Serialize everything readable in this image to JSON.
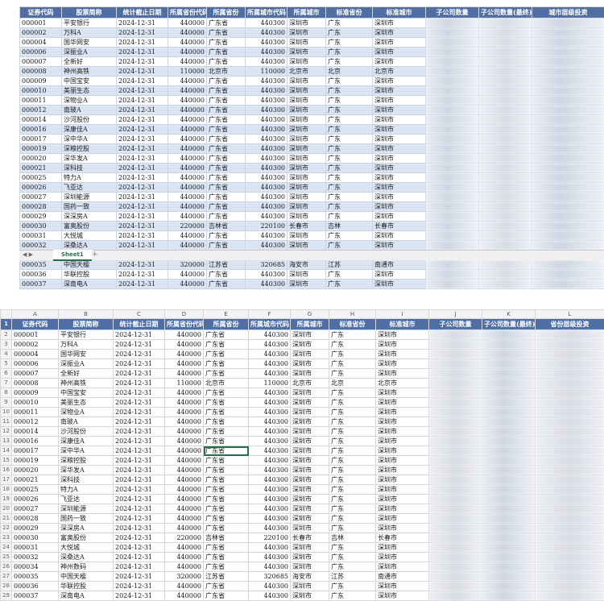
{
  "headers": [
    "证券代码",
    "股票简称",
    "统计截止日期",
    "所属省份代码",
    "所属省份",
    "所属城市代码",
    "所属城市",
    "标准省份",
    "标准城市",
    "子公司数量",
    "子公司数量(最终)",
    "城市层级投资"
  ],
  "bottom_headers": [
    "证券代码",
    "股票简称",
    "统计截止日期",
    "所属省份代码",
    "所属省份",
    "所属城市代码",
    "所属城市",
    "标准省份",
    "标准城市",
    "子公司数量",
    "子公司数量(最终)",
    "省份层级投资"
  ],
  "column_letters": [
    "A",
    "B",
    "C",
    "D",
    "E",
    "F",
    "G",
    "H",
    "I",
    "J",
    "K",
    "L"
  ],
  "sheet_tab": "Sheet1",
  "tab_nav": "◀ ▶",
  "add_sheet": "+",
  "top_last_col": [
    "",
    "",
    "",
    "",
    "",
    "",
    "",
    "",
    "",
    "",
    "",
    "",
    "",
    "",
    "",
    "",
    "",
    "",
    "",
    "",
    "",
    "",
    "",
    "",
    "",
    "",
    "",
    ""
  ],
  "bottom_last_col": [
    "",
    "",
    "",
    "",
    "",
    "",
    "",
    "",
    "",
    "",
    "",
    "",
    "",
    "",
    "",
    "",
    "",
    "",
    "",
    "",
    "",
    "",
    "",
    "",
    "",
    "",
    "",
    "",
    ""
  ],
  "top_rows": [
    [
      "000001",
      "平安银行",
      "2024-12-31",
      "440000",
      "广东省",
      "440300",
      "深圳市",
      "广东",
      "深圳市"
    ],
    [
      "000002",
      "万科A",
      "2024-12-31",
      "440000",
      "广东省",
      "440300",
      "深圳市",
      "广东",
      "深圳市"
    ],
    [
      "000004",
      "国华网安",
      "2024-12-31",
      "440000",
      "广东省",
      "440300",
      "深圳市",
      "广东",
      "深圳市"
    ],
    [
      "000006",
      "深振业A",
      "2024-12-31",
      "440000",
      "广东省",
      "440300",
      "深圳市",
      "广东",
      "深圳市"
    ],
    [
      "000007",
      "全新好",
      "2024-12-31",
      "440000",
      "广东省",
      "440300",
      "深圳市",
      "广东",
      "深圳市"
    ],
    [
      "000008",
      "神州高铁",
      "2024-12-31",
      "110000",
      "北京市",
      "110000",
      "北京市",
      "北京",
      "北京市"
    ],
    [
      "000009",
      "中国宝安",
      "2024-12-31",
      "440000",
      "广东省",
      "440300",
      "深圳市",
      "广东",
      "深圳市"
    ],
    [
      "000010",
      "美丽生态",
      "2024-12-31",
      "440000",
      "广东省",
      "440300",
      "深圳市",
      "广东",
      "深圳市"
    ],
    [
      "000011",
      "深物业A",
      "2024-12-31",
      "440000",
      "广东省",
      "440300",
      "深圳市",
      "广东",
      "深圳市"
    ],
    [
      "000012",
      "南玻A",
      "2024-12-31",
      "440000",
      "广东省",
      "440300",
      "深圳市",
      "广东",
      "深圳市"
    ],
    [
      "000014",
      "沙河股份",
      "2024-12-31",
      "440000",
      "广东省",
      "440300",
      "深圳市",
      "广东",
      "深圳市"
    ],
    [
      "000016",
      "深康佳A",
      "2024-12-31",
      "440000",
      "广东省",
      "440300",
      "深圳市",
      "广东",
      "深圳市"
    ],
    [
      "000017",
      "深中华A",
      "2024-12-31",
      "440000",
      "广东省",
      "440300",
      "深圳市",
      "广东",
      "深圳市"
    ],
    [
      "000019",
      "深粮控股",
      "2024-12-31",
      "440000",
      "广东省",
      "440300",
      "深圳市",
      "广东",
      "深圳市"
    ],
    [
      "000020",
      "深华发A",
      "2024-12-31",
      "440000",
      "广东省",
      "440300",
      "深圳市",
      "广东",
      "深圳市"
    ],
    [
      "000021",
      "深科技",
      "2024-12-31",
      "440000",
      "广东省",
      "440300",
      "深圳市",
      "广东",
      "深圳市"
    ],
    [
      "000025",
      "特力A",
      "2024-12-31",
      "440000",
      "广东省",
      "440300",
      "深圳市",
      "广东",
      "深圳市"
    ],
    [
      "000026",
      "飞亚达",
      "2024-12-31",
      "440000",
      "广东省",
      "440300",
      "深圳市",
      "广东",
      "深圳市"
    ],
    [
      "000027",
      "深圳能源",
      "2024-12-31",
      "440000",
      "广东省",
      "440300",
      "深圳市",
      "广东",
      "深圳市"
    ],
    [
      "000028",
      "国药一致",
      "2024-12-31",
      "440000",
      "广东省",
      "440300",
      "深圳市",
      "广东",
      "深圳市"
    ],
    [
      "000029",
      "深深房A",
      "2024-12-31",
      "440000",
      "广东省",
      "440300",
      "深圳市",
      "广东",
      "深圳市"
    ],
    [
      "000030",
      "富奥股份",
      "2024-12-31",
      "220000",
      "吉林省",
      "220100",
      "长春市",
      "吉林",
      "长春市"
    ],
    [
      "000031",
      "大悦城",
      "2024-12-31",
      "440000",
      "广东省",
      "440300",
      "深圳市",
      "广东",
      "深圳市"
    ],
    [
      "000032",
      "深桑达A",
      "2024-12-31",
      "440000",
      "广东省",
      "440300",
      "深圳市",
      "广东",
      "深圳市"
    ],
    [
      "000034",
      "神州数码",
      "2024-12-31",
      "440000",
      "广东省",
      "440300",
      "深圳市",
      "广东",
      "深圳市"
    ],
    [
      "000035",
      "中国天楹",
      "2024-12-31",
      "320000",
      "江苏省",
      "320685",
      "海安市",
      "江苏",
      "南通市"
    ],
    [
      "000036",
      "华联控股",
      "2024-12-31",
      "440000",
      "广东省",
      "440300",
      "深圳市",
      "广东",
      "深圳市"
    ],
    [
      "000037",
      "深南电A",
      "2024-12-31",
      "440000",
      "广东省",
      "440300",
      "深圳市",
      "广东",
      "深圳市"
    ]
  ],
  "bottom_rows": [
    [
      "000001",
      "平安银行",
      "2024-12-31",
      "440000",
      "广东省",
      "440300",
      "深圳市",
      "广东",
      "深圳市"
    ],
    [
      "000002",
      "万科A",
      "2024-12-31",
      "440000",
      "广东省",
      "440300",
      "深圳市",
      "广东",
      "深圳市"
    ],
    [
      "000004",
      "国华网安",
      "2024-12-31",
      "440000",
      "广东省",
      "440300",
      "深圳市",
      "广东",
      "深圳市"
    ],
    [
      "000006",
      "深振业A",
      "2024-12-31",
      "440000",
      "广东省",
      "440300",
      "深圳市",
      "广东",
      "深圳市"
    ],
    [
      "000007",
      "全新好",
      "2024-12-31",
      "440000",
      "广东省",
      "440300",
      "深圳市",
      "广东",
      "深圳市"
    ],
    [
      "000008",
      "神州高铁",
      "2024-12-31",
      "110000",
      "北京市",
      "110000",
      "北京市",
      "北京",
      "北京市"
    ],
    [
      "000009",
      "中国宝安",
      "2024-12-31",
      "440000",
      "广东省",
      "440300",
      "深圳市",
      "广东",
      "深圳市"
    ],
    [
      "000010",
      "美丽生态",
      "2024-12-31",
      "440000",
      "广东省",
      "440300",
      "深圳市",
      "广东",
      "深圳市"
    ],
    [
      "000011",
      "深物业A",
      "2024-12-31",
      "440000",
      "广东省",
      "440300",
      "深圳市",
      "广东",
      "深圳市"
    ],
    [
      "000012",
      "南玻A",
      "2024-12-31",
      "440000",
      "广东省",
      "440300",
      "深圳市",
      "广东",
      "深圳市"
    ],
    [
      "000014",
      "沙河股份",
      "2024-12-31",
      "440000",
      "广东省",
      "440300",
      "深圳市",
      "广东",
      "深圳市"
    ],
    [
      "000016",
      "深康佳A",
      "2024-12-31",
      "440000",
      "广东省",
      "440300",
      "深圳市",
      "广东",
      "深圳市"
    ],
    [
      "000017",
      "深中华A",
      "2024-12-31",
      "440000",
      "广东省",
      "440300",
      "深圳市",
      "广东",
      "深圳市"
    ],
    [
      "000019",
      "深粮控股",
      "2024-12-31",
      "440000",
      "广东省",
      "440300",
      "深圳市",
      "广东",
      "深圳市"
    ],
    [
      "000020",
      "深华发A",
      "2024-12-31",
      "440000",
      "广东省",
      "440300",
      "深圳市",
      "广东",
      "深圳市"
    ],
    [
      "000021",
      "深科技",
      "2024-12-31",
      "440000",
      "广东省",
      "440300",
      "深圳市",
      "广东",
      "深圳市"
    ],
    [
      "000025",
      "特力A",
      "2024-12-31",
      "440000",
      "广东省",
      "440300",
      "深圳市",
      "广东",
      "深圳市"
    ],
    [
      "000026",
      "飞亚达",
      "2024-12-31",
      "440000",
      "广东省",
      "440300",
      "深圳市",
      "广东",
      "深圳市"
    ],
    [
      "000027",
      "深圳能源",
      "2024-12-31",
      "440000",
      "广东省",
      "440300",
      "深圳市",
      "广东",
      "深圳市"
    ],
    [
      "000028",
      "国药一致",
      "2024-12-31",
      "440000",
      "广东省",
      "440300",
      "深圳市",
      "广东",
      "深圳市"
    ],
    [
      "000029",
      "深深房A",
      "2024-12-31",
      "440000",
      "广东省",
      "440300",
      "深圳市",
      "广东",
      "深圳市"
    ],
    [
      "000030",
      "富奥股份",
      "2024-12-31",
      "220000",
      "吉林省",
      "220100",
      "长春市",
      "吉林",
      "长春市"
    ],
    [
      "000031",
      "大悦城",
      "2024-12-31",
      "440000",
      "广东省",
      "440300",
      "深圳市",
      "广东",
      "深圳市"
    ],
    [
      "000032",
      "深桑达A",
      "2024-12-31",
      "440000",
      "广东省",
      "440300",
      "深圳市",
      "广东",
      "深圳市"
    ],
    [
      "000034",
      "神州数码",
      "2024-12-31",
      "440000",
      "广东省",
      "440300",
      "深圳市",
      "广东",
      "深圳市"
    ],
    [
      "000035",
      "中国天楹",
      "2024-12-31",
      "320000",
      "江苏省",
      "320685",
      "海安市",
      "江苏",
      "南通市"
    ],
    [
      "000036",
      "华联控股",
      "2024-12-31",
      "440000",
      "广东省",
      "440300",
      "深圳市",
      "广东",
      "深圳市"
    ],
    [
      "000037",
      "深南电A",
      "2024-12-31",
      "440000",
      "广东省",
      "440300",
      "深圳市",
      "广东",
      "深圳市"
    ]
  ],
  "bottom_row_numbers": [
    "1",
    "2",
    "3",
    "4",
    "5",
    "6",
    "7",
    "8",
    "9",
    "10",
    "11",
    "12",
    "13",
    "14",
    "15",
    "16",
    "17",
    "18",
    "19",
    "20",
    "21",
    "22",
    "23",
    "24",
    "25",
    "26",
    "27",
    "28",
    "29"
  ],
  "selected_cell": "E14"
}
